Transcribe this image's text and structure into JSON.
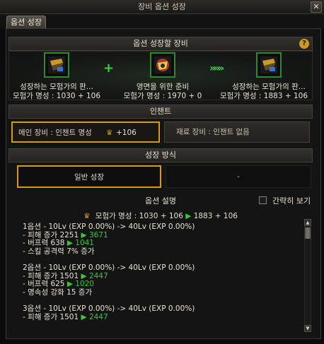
{
  "window": {
    "title": "장비 옵션 성장",
    "close_symbol": "✕"
  },
  "tabs": [
    {
      "label": "옵션 성장"
    }
  ],
  "sections": {
    "target_equipment": "옵션 성장할 장비",
    "enchant": "인챈트",
    "growth_method": "성장 방식"
  },
  "help_symbol": "?",
  "equipment": {
    "left": {
      "name": "성장하는 모험가의 판...",
      "stat": "모험가 명성 : 1030 + 106"
    },
    "middle": {
      "name": "영면을 위한 준비",
      "stat": "모험가 명성 : 1970 + 0"
    },
    "right": {
      "name": "성장하는 모험가의 판...",
      "stat": "모험가 명성 : 1883 + 106"
    },
    "plus_symbol": "+",
    "arrow_symbol": "»»»"
  },
  "enchant": {
    "main_label": "메인 장비 : 인챈트 명성",
    "main_value": "+106",
    "sub_label": "재료 장비 : 인챈트 없음"
  },
  "method": {
    "normal_label": "일반 성장",
    "other_label": "-"
  },
  "options": {
    "title": "옵션 설명",
    "brief_label": "간략히 보기",
    "fame": {
      "prefix": "모험가 명성 : 1030 + 106",
      "arrow": "▶",
      "to": "1883 + 106"
    },
    "groups": [
      {
        "head": "1옵션 - 10Lv (EXP 0.00%) -> 40Lv (EXP 0.00%)",
        "lines": [
          {
            "text": "- 피해 증가 2251",
            "arrow": "▶",
            "to": "3671"
          },
          {
            "text": "- 버프력 638",
            "arrow": "▶",
            "to": "1041"
          },
          {
            "text": "- 스킬 공격력 7% 증가",
            "arrow": "",
            "to": ""
          }
        ]
      },
      {
        "head": "2옵션 - 10Lv (EXP 0.00%) -> 40Lv (EXP 0.00%)",
        "lines": [
          {
            "text": "- 피해 증가 1501",
            "arrow": "▶",
            "to": "2447"
          },
          {
            "text": "- 버프력 625",
            "arrow": "▶",
            "to": "1020"
          },
          {
            "text": "- 명속성 강화 15 증가",
            "arrow": "",
            "to": ""
          }
        ]
      },
      {
        "head": "3옵션 - 10Lv (EXP 0.00%) -> 40Lv (EXP 0.00%)",
        "lines": [
          {
            "text": "- 피해 증가 1501",
            "arrow": "▶",
            "to": "2447"
          }
        ]
      }
    ]
  },
  "colors": {
    "accent_gold": "#d89a18",
    "green": "#39c639",
    "slot_border": "#2e8a2e"
  },
  "icons": {
    "help": "question-icon",
    "plus": "plus-icon",
    "arrow": "triple-chevron-icon",
    "fame": "fame-emblem-icon",
    "checkbox": "checkbox-icon"
  }
}
